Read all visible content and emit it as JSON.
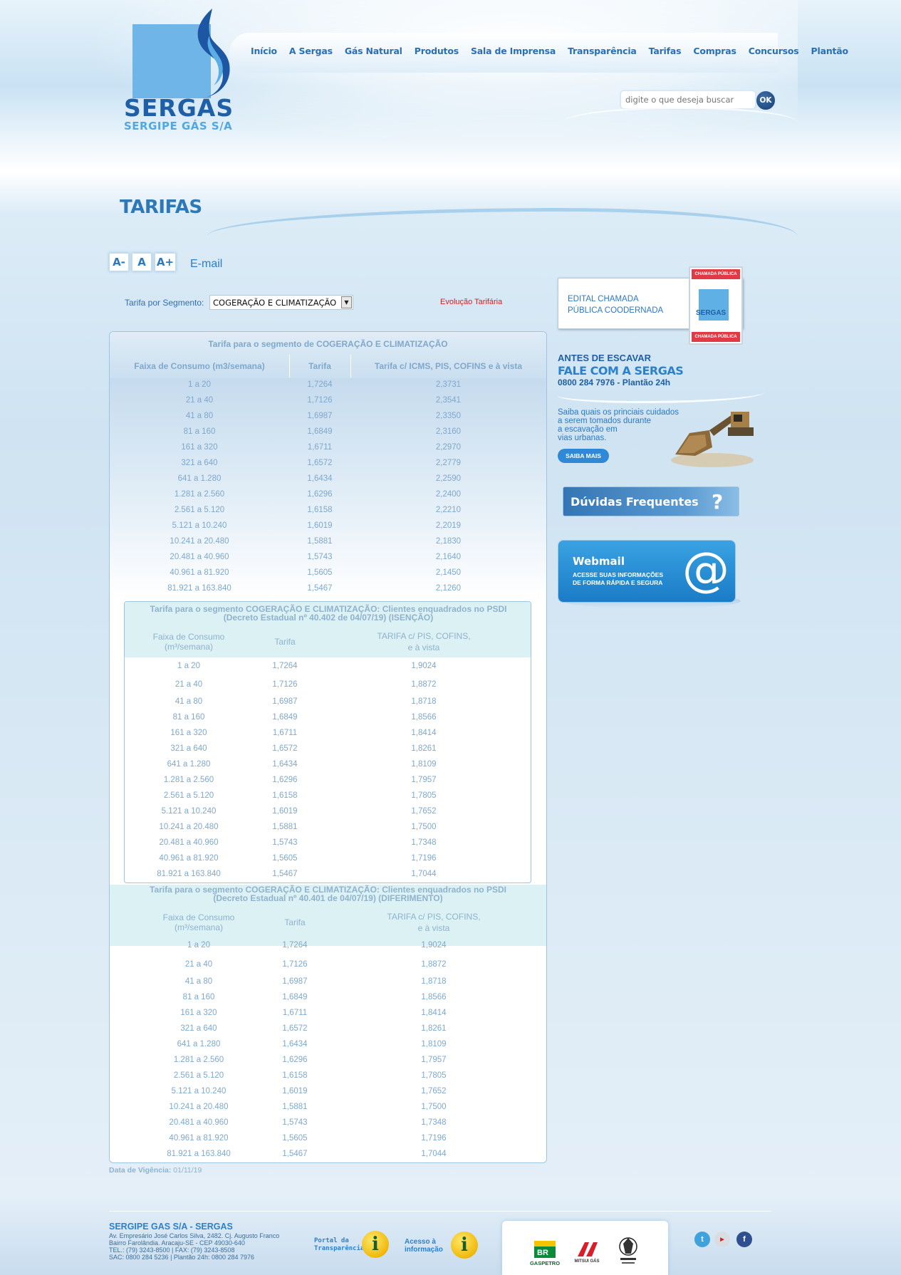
{
  "brand": {
    "name": "SERGAS",
    "subtitle": "SERGIPE GÁS S/A",
    "colors": {
      "primary": "#1e5fa8",
      "accent": "#2c80cc",
      "light": "#6fb5e8",
      "link_red": "#e0191f"
    }
  },
  "nav": {
    "items": [
      "Início",
      "A Sergas",
      "Gás Natural",
      "Produtos",
      "Sala de Imprensa",
      "Transparência",
      "Tarifas",
      "Compras",
      "Concursos",
      "Plantão"
    ]
  },
  "search": {
    "placeholder": "digite o que deseja buscar",
    "button_label": "OK"
  },
  "page": {
    "title": "TARIFAS",
    "font_tools": [
      "A-",
      "A",
      "A+"
    ],
    "email_label": "E-mail",
    "segment_label": "Tarifa por Segmento:",
    "segment_value": "COGERAÇÃO E CLIMATIZAÇÃO",
    "evolution_link": "Evolução Tarifária",
    "validity_label": "Data de Vigência:",
    "validity_value": "01/11/19"
  },
  "table_main": {
    "title": "Tarifa para o segmento de COGERAÇÃO E CLIMATIZAÇÃO",
    "columns": [
      "Faixa de Consumo (m3/semana)",
      "Tarifa",
      "Tarifa c/ ICMS, PIS, COFINS e à vista"
    ],
    "rows": [
      [
        "1 a 20",
        "1,7264",
        "2,3731"
      ],
      [
        "21 a 40",
        "1,7126",
        "2,3541"
      ],
      [
        "41 a 80",
        "1,6987",
        "2,3350"
      ],
      [
        "81 a 160",
        "1,6849",
        "2,3160"
      ],
      [
        "161 a 320",
        "1,6711",
        "2,2970"
      ],
      [
        "321 a 640",
        "1,6572",
        "2,2779"
      ],
      [
        "641 a 1.280",
        "1,6434",
        "2,2590"
      ],
      [
        "1.281 a 2.560",
        "1,6296",
        "2,2400"
      ],
      [
        "2.561 a 5.120",
        "1,6158",
        "2,2210"
      ],
      [
        "5.121 a 10.240",
        "1,6019",
        "2,2019"
      ],
      [
        "10.241 a 20.480",
        "1,5881",
        "2,1830"
      ],
      [
        "20.481 a 40.960",
        "1,5743",
        "2,1640"
      ],
      [
        "40.961 a 81.920",
        "1,5605",
        "2,1450"
      ],
      [
        "81.921 a 163.840",
        "1,5467",
        "2,1260"
      ]
    ]
  },
  "table_psdi_isencao": {
    "title_line1": "Tarifa para o segmento COGERAÇÃO E CLIMATIZAÇÃO: Clientes enquadrados no PSDI",
    "title_line2": "(Decreto Estadual nº 40.402 de 04/07/19) (ISENÇÃO)",
    "col1_line1": "Faixa de Consumo",
    "col1_line2": "(m³/semana)",
    "col2": "Tarifa",
    "col3_line1": "TARIFA c/ PIS, COFINS,",
    "col3_line2": "e à vista",
    "rows": [
      [
        "1 a 20",
        "1,7264",
        "1,9024"
      ],
      [
        "21 a 40",
        "1,7126",
        "1,8872"
      ],
      [
        "41 a 80",
        "1,6987",
        "1,8718"
      ],
      [
        "81 a 160",
        "1,6849",
        "1,8566"
      ],
      [
        "161 a 320",
        "1,6711",
        "1,8414"
      ],
      [
        "321 a 640",
        "1,6572",
        "1,8261"
      ],
      [
        "641 a 1.280",
        "1,6434",
        "1,8109"
      ],
      [
        "1.281 a 2.560",
        "1,6296",
        "1,7957"
      ],
      [
        "2.561 a 5.120",
        "1,6158",
        "1,7805"
      ],
      [
        "5.121 a 10.240",
        "1,6019",
        "1,7652"
      ],
      [
        "10.241 a 20.480",
        "1,5881",
        "1,7500"
      ],
      [
        "20.481 a 40.960",
        "1,5743",
        "1,7348"
      ],
      [
        "40.961 a 81.920",
        "1,5605",
        "1,7196"
      ],
      [
        "81.921 a 163.840",
        "1,5467",
        "1,7044"
      ]
    ]
  },
  "table_psdi_diferimento": {
    "title_line1": "Tarifa para o segmento COGERAÇÃO E CLIMATIZAÇÃO: Clientes enquadrados no PSDI",
    "title_line2": "(Decreto Estadual nº 40.401 de 04/07/19) (DIFERIMENTO)",
    "col1_line1": "Faixa de Consumo",
    "col1_line2": "(m³/semana)",
    "col2": "Tarifa",
    "col3_line1": "TARIFA c/ PIS, COFINS,",
    "col3_line2": "e à vista",
    "rows": [
      [
        "1 a 20",
        "1,7264",
        "1,9024"
      ],
      [
        "21 a 40",
        "1,7126",
        "1,8872"
      ],
      [
        "41 a 80",
        "1,6987",
        "1,8718"
      ],
      [
        "81 a 160",
        "1,6849",
        "1,8566"
      ],
      [
        "161 a 320",
        "1,6711",
        "1,8414"
      ],
      [
        "321 a 640",
        "1,6572",
        "1,8261"
      ],
      [
        "641 a 1.280",
        "1,6434",
        "1,8109"
      ],
      [
        "1.281 a 2.560",
        "1,6296",
        "1,7957"
      ],
      [
        "2.561 a 5.120",
        "1,6158",
        "1,7805"
      ],
      [
        "5.121 a 10.240",
        "1,6019",
        "1,7652"
      ],
      [
        "10.241 a 20.480",
        "1,5881",
        "1,7500"
      ],
      [
        "20.481 a 40.960",
        "1,5743",
        "1,7348"
      ],
      [
        "40.961 a 81.920",
        "1,5605",
        "1,7196"
      ],
      [
        "81.921 a 163.840",
        "1,5467",
        "1,7044"
      ]
    ]
  },
  "sidebar": {
    "edital_line1": "EDITAL CHAMADA",
    "edital_line2": "PÚBLICA COODERNADA",
    "chip_label": "CHAMADA PÚBLICA",
    "chip_brand": "SERGAS",
    "antes_line1": "ANTES DE ESCAVAR",
    "antes_line2": "FALE COM A SERGAS",
    "antes_line3": "0800 284 7976 - Plantão 24h",
    "saiba_lines": [
      "Saiba quais os princiais cuidados",
      "a serem tomados durante",
      "a escavação em",
      "vias urbanas."
    ],
    "saiba_button": "SAIBA MAIS",
    "duvidas_label": "Dúvidas Frequentes",
    "webmail_title": "Webmail",
    "webmail_sub1": "ACESSE SUAS INFORMAÇÕES",
    "webmail_sub2": "DE FORMA RÁPIDA E SEGURA"
  },
  "footer": {
    "company": "SERGIPE GAS S/A - SERGAS",
    "address_lines": [
      "Av. Empresário José Carlos Silva, 2482. Cj. Augusto Franco",
      "Bairro Farolândia. Aracaju-SE - CEP 49030-640",
      "TEL.: (79) 3243-8500 | FAX: (79) 3243-8508",
      "SAC: 0800 284 5236 | Plantão 24h: 0800 284 7976"
    ],
    "portal_line1": "Portal da",
    "portal_line2": "Transparência",
    "acesso_line1": "Acesso à",
    "acesso_line2": "informação",
    "partners": [
      "GASPETRO",
      "MITSUI GÁS"
    ],
    "social_icons": [
      "twitter-icon",
      "youtube-icon",
      "facebook-icon"
    ]
  }
}
